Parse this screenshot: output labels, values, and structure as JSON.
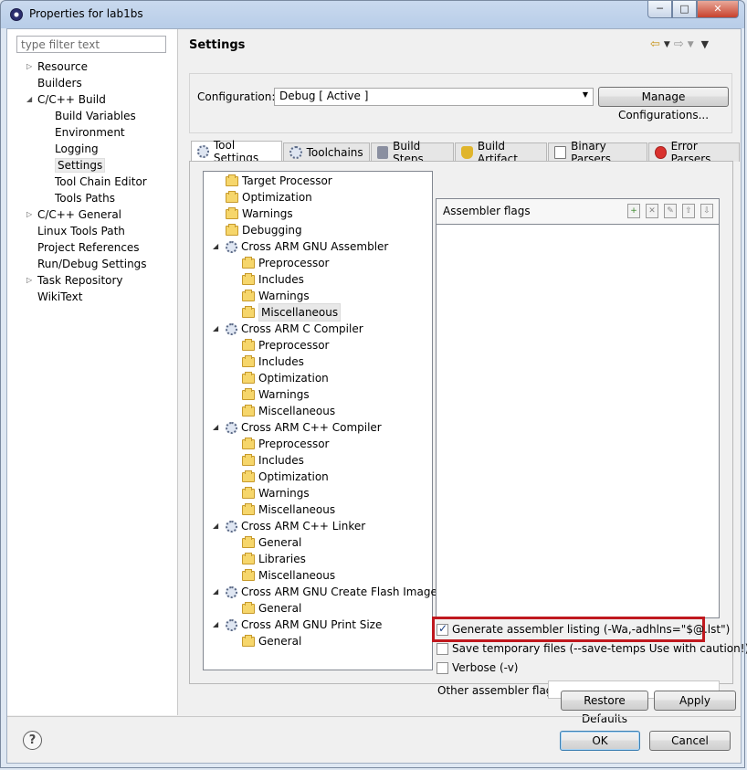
{
  "window": {
    "title": "Properties for lab1bs",
    "controls": [
      "minimize",
      "maximize",
      "close"
    ]
  },
  "left_pane": {
    "filter_placeholder": "type filter text",
    "items": [
      {
        "label": "Resource",
        "level": 0,
        "toggle": "collapsed"
      },
      {
        "label": "Builders",
        "level": 0,
        "toggle": "none"
      },
      {
        "label": "C/C++ Build",
        "level": 0,
        "toggle": "expanded"
      },
      {
        "label": "Build Variables",
        "level": 1,
        "toggle": "none"
      },
      {
        "label": "Environment",
        "level": 1,
        "toggle": "none"
      },
      {
        "label": "Logging",
        "level": 1,
        "toggle": "none"
      },
      {
        "label": "Settings",
        "level": 1,
        "toggle": "none",
        "selected": true
      },
      {
        "label": "Tool Chain Editor",
        "level": 1,
        "toggle": "none"
      },
      {
        "label": "Tools Paths",
        "level": 1,
        "toggle": "none"
      },
      {
        "label": "C/C++ General",
        "level": 0,
        "toggle": "collapsed"
      },
      {
        "label": "Linux Tools Path",
        "level": 0,
        "toggle": "none"
      },
      {
        "label": "Project References",
        "level": 0,
        "toggle": "none"
      },
      {
        "label": "Run/Debug Settings",
        "level": 0,
        "toggle": "none"
      },
      {
        "label": "Task Repository",
        "level": 0,
        "toggle": "collapsed"
      },
      {
        "label": "WikiText",
        "level": 0,
        "toggle": "none"
      }
    ]
  },
  "header": {
    "title": "Settings"
  },
  "configuration": {
    "label": "Configuration:",
    "value": "Debug  [ Active ]",
    "manage_button": "Manage Configurations..."
  },
  "tabs": [
    {
      "label": "Tool Settings",
      "icon": "gear-icon",
      "active": true
    },
    {
      "label": "Toolchains",
      "icon": "gear-icon"
    },
    {
      "label": "Build Steps",
      "icon": "hammer-icon"
    },
    {
      "label": "Build Artifact",
      "icon": "trophy-icon"
    },
    {
      "label": "Binary Parsers",
      "icon": "binary-icon"
    },
    {
      "label": "Error Parsers",
      "icon": "error-icon"
    }
  ],
  "options_tree": [
    {
      "label": "Target Processor",
      "icon": "folder",
      "indent": 0
    },
    {
      "label": "Optimization",
      "icon": "folder",
      "indent": 0
    },
    {
      "label": "Warnings",
      "icon": "folder",
      "indent": 0
    },
    {
      "label": "Debugging",
      "icon": "folder",
      "indent": 0
    },
    {
      "label": "Cross ARM GNU Assembler",
      "icon": "gear",
      "indent": 0,
      "toggle": "expanded"
    },
    {
      "label": "Preprocessor",
      "icon": "folder",
      "indent": 1
    },
    {
      "label": "Includes",
      "icon": "folder",
      "indent": 1
    },
    {
      "label": "Warnings",
      "icon": "folder",
      "indent": 1
    },
    {
      "label": "Miscellaneous",
      "icon": "folder",
      "indent": 1,
      "selected": true
    },
    {
      "label": "Cross ARM C Compiler",
      "icon": "gear",
      "indent": 0,
      "toggle": "expanded"
    },
    {
      "label": "Preprocessor",
      "icon": "folder",
      "indent": 1
    },
    {
      "label": "Includes",
      "icon": "folder",
      "indent": 1
    },
    {
      "label": "Optimization",
      "icon": "folder",
      "indent": 1
    },
    {
      "label": "Warnings",
      "icon": "folder",
      "indent": 1
    },
    {
      "label": "Miscellaneous",
      "icon": "folder",
      "indent": 1
    },
    {
      "label": "Cross ARM C++ Compiler",
      "icon": "gear",
      "indent": 0,
      "toggle": "expanded"
    },
    {
      "label": "Preprocessor",
      "icon": "folder",
      "indent": 1
    },
    {
      "label": "Includes",
      "icon": "folder",
      "indent": 1
    },
    {
      "label": "Optimization",
      "icon": "folder",
      "indent": 1
    },
    {
      "label": "Warnings",
      "icon": "folder",
      "indent": 1
    },
    {
      "label": "Miscellaneous",
      "icon": "folder",
      "indent": 1
    },
    {
      "label": "Cross ARM C++ Linker",
      "icon": "gear",
      "indent": 0,
      "toggle": "expanded"
    },
    {
      "label": "General",
      "icon": "folder",
      "indent": 1
    },
    {
      "label": "Libraries",
      "icon": "folder",
      "indent": 1
    },
    {
      "label": "Miscellaneous",
      "icon": "folder",
      "indent": 1
    },
    {
      "label": "Cross ARM GNU Create Flash Image",
      "icon": "gear",
      "indent": 0,
      "toggle": "expanded"
    },
    {
      "label": "General",
      "icon": "folder",
      "indent": 1
    },
    {
      "label": "Cross ARM GNU Print Size",
      "icon": "gear",
      "indent": 0,
      "toggle": "expanded"
    },
    {
      "label": "General",
      "icon": "folder",
      "indent": 1
    }
  ],
  "flags": {
    "title": "Assembler flags",
    "tools": [
      "add-icon",
      "delete-icon",
      "edit-icon",
      "move-up-icon",
      "move-down-icon"
    ]
  },
  "options": [
    {
      "label": "Generate assembler listing (-Wa,-adhlns=\"$@.lst\")",
      "checked": true,
      "highlighted": true
    },
    {
      "label": "Save temporary files (--save-temps Use with caution!)",
      "checked": false
    },
    {
      "label": "Verbose (-v)",
      "checked": false
    }
  ],
  "other_flags": {
    "label": "Other assembler flags",
    "value": ""
  },
  "buttons": {
    "restore_defaults": "Restore Defaults",
    "apply": "Apply",
    "ok": "OK",
    "cancel": "Cancel",
    "help": "?"
  },
  "colors": {
    "highlight_border": "#c0181e",
    "folder_fill": "#f6d66b"
  }
}
